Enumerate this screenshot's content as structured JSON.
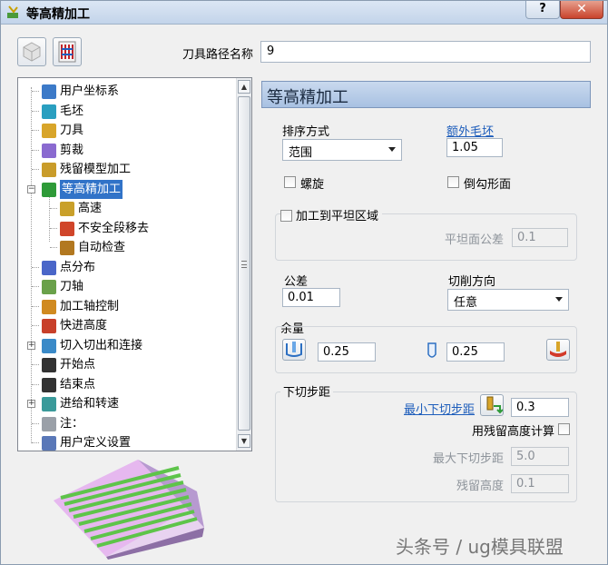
{
  "window": {
    "title": "等高精加工",
    "help": "?",
    "close": "✕"
  },
  "toolbar": {
    "path_name_label": "刀具路径名称",
    "path_name_value": "9"
  },
  "tree": {
    "items": [
      {
        "label": "用户坐标系",
        "icon": "ucs-icon"
      },
      {
        "label": "毛坯",
        "icon": "block-icon"
      },
      {
        "label": "刀具",
        "icon": "tool-icon"
      },
      {
        "label": "剪裁",
        "icon": "limit-icon"
      },
      {
        "label": "残留模型加工",
        "icon": "rest-model-icon"
      },
      {
        "label": "等高精加工",
        "icon": "constant-z-icon",
        "selected": true
      },
      {
        "label": "高速",
        "icon": "high-speed-icon"
      },
      {
        "label": "不安全段移去",
        "icon": "unsafe-removal-icon"
      },
      {
        "label": "自动检查",
        "icon": "auto-check-icon"
      },
      {
        "label": "点分布",
        "icon": "point-distribution-icon"
      },
      {
        "label": "刀轴",
        "icon": "tool-axis-icon"
      },
      {
        "label": "加工轴控制",
        "icon": "axis-control-icon"
      },
      {
        "label": "快进高度",
        "icon": "rapid-height-icon"
      },
      {
        "label": "切入切出和连接",
        "icon": "leads-links-icon"
      },
      {
        "label": "开始点",
        "icon": "start-point-icon"
      },
      {
        "label": "结束点",
        "icon": "end-point-icon"
      },
      {
        "label": "进给和转速",
        "icon": "feeds-speeds-icon"
      },
      {
        "label": "注：",
        "icon": "notes-icon"
      },
      {
        "label": "用户定义设置",
        "icon": "user-settings-icon"
      }
    ]
  },
  "panel": {
    "header": "等高精加工",
    "ordering_label": "排序方式",
    "ordering_value": "范围",
    "extra_stock_label": "额外毛坯",
    "extra_stock_value": "1.05",
    "spiral_label": "螺旋",
    "undercut_label": "倒勾形面",
    "flat_machining_label": "加工到平坦区域",
    "flat_tolerance_label": "平坦面公差",
    "flat_tolerance_value": "0.1",
    "tolerance_label": "公差",
    "tolerance_value": "0.01",
    "cut_direction_label": "切削方向",
    "cut_direction_value": "任意",
    "allowance_label": "余量",
    "radial_allowance_value": "0.25",
    "axial_allowance_value": "0.25",
    "stepdown_label": "下切步距",
    "min_stepdown_label": "最小下切步距",
    "min_stepdown_value": "0.3",
    "use_cusp_label": "用残留高度计算",
    "max_stepdown_label": "最大下切步距",
    "max_stepdown_value": "5.0",
    "cusp_height_label": "残留高度",
    "cusp_height_value": "0.1"
  },
  "watermark": "头条号 / ug模具联盟"
}
